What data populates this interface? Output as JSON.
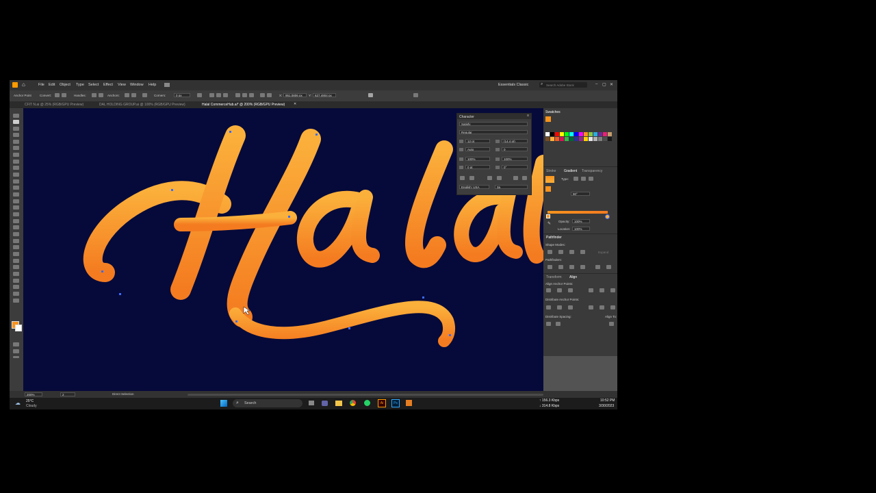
{
  "menu": [
    "File",
    "Edit",
    "Object",
    "Type",
    "Select",
    "Effect",
    "View",
    "Window",
    "Help"
  ],
  "workspace": "Essentials Classic",
  "search_placeholder": "Search Adobe Stock",
  "control": {
    "selection": "Anchor Point",
    "convert": "Convert:",
    "handles": "Handles:",
    "anchors": "Anchors:",
    "corners": "Corners:",
    "corners_value": "0 px",
    "x_label": "X:",
    "x_value": "951.0806 px",
    "y_label": "Y:",
    "y_value": "627.4904 px"
  },
  "tabs": [
    {
      "label": "CFIT N.ai @ 25% (RGB/GPU Preview)",
      "active": false
    },
    {
      "label": "DAL HOLDING GROUP.ai @ 100% (RGB/GPU Preview)",
      "active": false
    },
    {
      "label": "Halal CommerceHub.ai* @ 200% (RGB/GPU Preview)",
      "active": true
    }
  ],
  "artwork": {
    "text": "Halal",
    "gradient_top": "#fbb03b",
    "gradient_bottom": "#f47b20",
    "background": "#060a3a"
  },
  "character_panel": {
    "title": "Character",
    "font_family": "Satisfy",
    "font_style": "Regular",
    "size": "12 pt",
    "leading": "(14.4 pt)",
    "kerning": "Auto",
    "tracking": "0",
    "vscale": "100%",
    "hscale": "100%",
    "baseline": "0 pt",
    "rotation": "0°",
    "language": "English: USA",
    "aa": "3a"
  },
  "swatches": {
    "title": "Swatches",
    "colors": [
      "#ffffff",
      "#000000",
      "#ff0000",
      "#ffff00",
      "#00ff00",
      "#00ffff",
      "#0000ff",
      "#ff00ff",
      "#f7931e",
      "#8cc63f",
      "#29abe2",
      "#662d91",
      "#ed1e79",
      "#c69c6d",
      "#754c24",
      "#fbb03b",
      "#f15a24",
      "#d4145a",
      "#39b54a",
      "#006837",
      "#2e3192",
      "#93278f",
      "#ffd400",
      "#e6e6e6",
      "#b3b3b3",
      "#808080",
      "#4d4d4d",
      "#1a1a1a"
    ]
  },
  "gradient_panel": {
    "tabs": [
      "Stroke",
      "Gradient",
      "Transparency"
    ],
    "type": "Type:",
    "angle": "90°",
    "opacity_label": "Opacity:",
    "opacity": "100%",
    "location_label": "Location:",
    "location": "100%",
    "from_color": "#f7931e",
    "to_color": "#fbb03b"
  },
  "pathfinder": {
    "title": "Pathfinder",
    "shape_modes": "Shape Modes:",
    "expand": "Expand",
    "pathfinders": "Pathfinders:"
  },
  "align": {
    "tabs": [
      "Transform",
      "Align"
    ],
    "anchor": "Align Anchor Points:",
    "distribute_anchor": "Distribute Anchor Points:",
    "distribute_spacing": "Distribute Spacing:",
    "align_to": "Align To:"
  },
  "status": {
    "zoom": "200%",
    "artboard": "2",
    "selection": "Direct Selection"
  },
  "taskbar": {
    "weather_temp": "25°C",
    "weather_desc": "Cloudy",
    "search": "Search",
    "net_up": "↑ 156.3 Kbps",
    "net_down": "↓ 314.8 Kbps",
    "time": "10:52 PM",
    "date": "3/30/2023"
  }
}
